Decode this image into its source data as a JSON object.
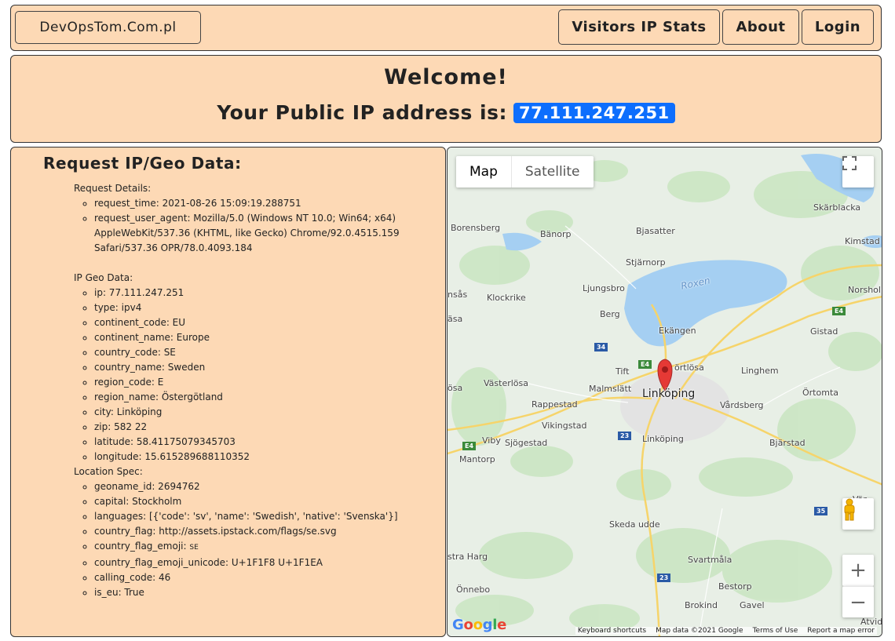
{
  "navbar": {
    "brand": "DevOpsTom.Com.pl",
    "links": [
      "Visitors IP Stats",
      "About",
      "Login"
    ]
  },
  "welcome": {
    "title": "Welcome!",
    "ip_prefix": "Your Public IP address is:",
    "ip": "77.111.247.251"
  },
  "geo": {
    "heading": "Request IP/Geo Data:",
    "request_details": {
      "title": "Request Details:",
      "items": [
        "request_time: 2021-08-26 15:09:19.288751",
        "request_user_agent: Mozilla/5.0 (Windows NT 10.0; Win64; x64) AppleWebKit/537.36 (KHTML, like Gecko) Chrome/92.0.4515.159 Safari/537.36 OPR/78.0.4093.184"
      ]
    },
    "ip_geo_data": {
      "title": "IP Geo Data:",
      "items": [
        "ip: 77.111.247.251",
        "type: ipv4",
        "continent_code: EU",
        "continent_name: Europe",
        "country_code: SE",
        "country_name: Sweden",
        "region_code: E",
        "region_name: Östergötland",
        "city: Linköping",
        "zip: 582 22",
        "latitude: 58.41175079345703",
        "longitude: 15.615289688110352"
      ]
    },
    "location_spec": {
      "title": "Location Spec:",
      "items": [
        "geoname_id: 2694762",
        "capital: Stockholm",
        "languages: [{'code': 'sv', 'name': 'Swedish', 'native': 'Svenska'}]",
        "country_flag: http://assets.ipstack.com/flags/se.svg",
        "country_flag_emoji_prefix: country_flag_emoji: ",
        "country_flag_emoji_unicode: U+1F1F8 U+1F1EA",
        "calling_code: 46",
        "is_eu: True"
      ],
      "flag_emoji_label": "country_flag_emoji:",
      "flag_emoji_value": "SE"
    }
  },
  "map": {
    "map_type_buttons": [
      "Map",
      "Satellite"
    ],
    "active_type": "Map",
    "footer": [
      "Keyboard shortcuts",
      "Map data ©2021 Google",
      "Terms of Use",
      "Report a map error"
    ],
    "google_logo": "Google",
    "places": [
      "Skärblacka",
      "Borensberg",
      "Bänorp",
      "Bjasatter",
      "Kimstad",
      "Stjärnorp",
      "Roxen",
      "Ljungsbro",
      "Norsholm",
      "nsås",
      "Klockrike",
      "Berg",
      "Gistad",
      "äsa",
      "Ekängen",
      "34",
      "E4",
      "Tift",
      "örtlösa",
      "Linghem",
      "Västerlösa",
      "Malmslätt",
      "Linköping",
      "Örtomta",
      "ösa",
      "Rappestad",
      "Vårdsberg",
      "Vikingstad",
      "23",
      "E4",
      "Viby",
      "Sjögestad",
      "Linköping",
      "Bjärstad",
      "Mantorp",
      "Vär",
      "35",
      "Skeda udde",
      "stra Harg",
      "Svartmåla",
      "23",
      "Önnebo",
      "Bestorp",
      "Brokind",
      "Gavel",
      "Atvid",
      "E4"
    ],
    "colors": {
      "land": "#e7eee5",
      "forest": "#c8e6c0",
      "water": "#aadaff",
      "road_major": "#f8d874",
      "pin": "#e53935"
    }
  }
}
